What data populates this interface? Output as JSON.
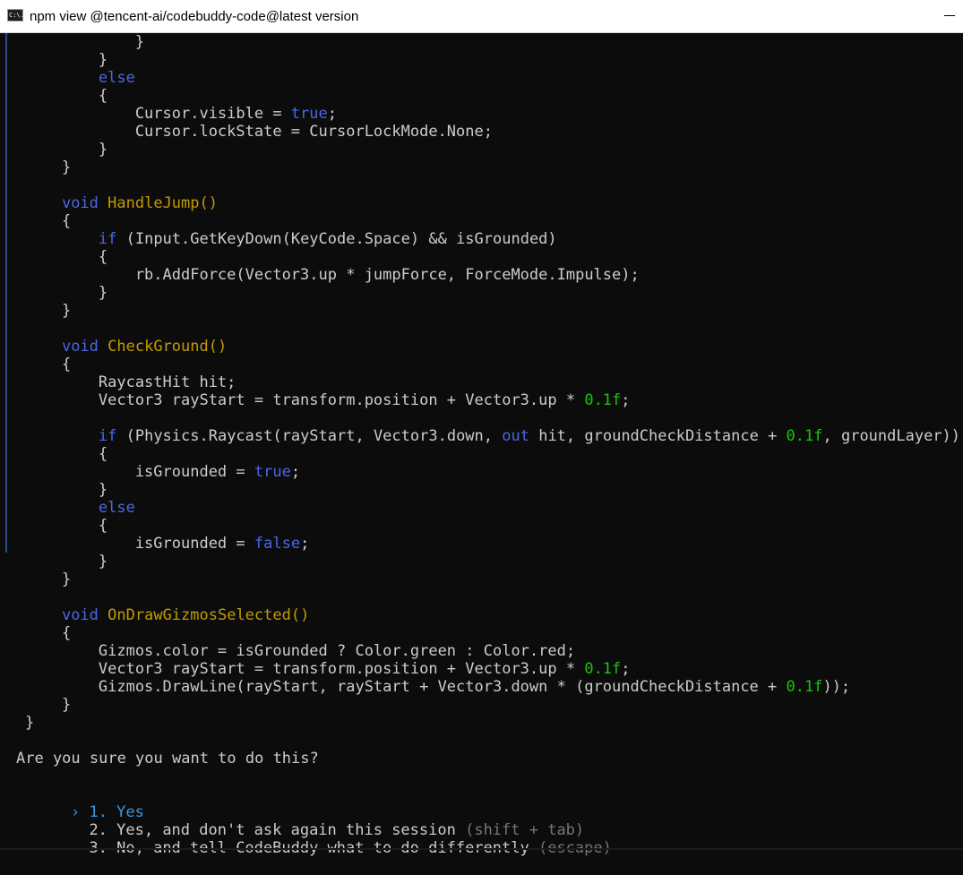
{
  "window": {
    "title": "npm view @tencent-ai/codebuddy-code@latest version",
    "icon": "console-window-icon",
    "icon_text": "C:\\."
  },
  "code_lines": [
    [
      {
        "t": "            }"
      }
    ],
    [
      {
        "t": "        }"
      }
    ],
    [
      {
        "t": "        "
      },
      {
        "t": "else",
        "c": "k"
      }
    ],
    [
      {
        "t": "        {"
      }
    ],
    [
      {
        "t": "            Cursor.visible = "
      },
      {
        "t": "true",
        "c": "k"
      },
      {
        "t": ";"
      }
    ],
    [
      {
        "t": "            Cursor.lockState = CursorLockMode.None;"
      }
    ],
    [
      {
        "t": "        }"
      }
    ],
    [
      {
        "t": "    }"
      }
    ],
    [
      {
        "t": ""
      }
    ],
    [
      {
        "t": "    "
      },
      {
        "t": "void",
        "c": "k"
      },
      {
        "t": " "
      },
      {
        "t": "HandleJump()",
        "c": "m"
      }
    ],
    [
      {
        "t": "    {"
      }
    ],
    [
      {
        "t": "        "
      },
      {
        "t": "if",
        "c": "k"
      },
      {
        "t": " (Input.GetKeyDown(KeyCode.Space) && isGrounded)"
      }
    ],
    [
      {
        "t": "        {"
      }
    ],
    [
      {
        "t": "            rb.AddForce(Vector3.up * jumpForce, ForceMode.Impulse);"
      }
    ],
    [
      {
        "t": "        }"
      }
    ],
    [
      {
        "t": "    }"
      }
    ],
    [
      {
        "t": ""
      }
    ],
    [
      {
        "t": "    "
      },
      {
        "t": "void",
        "c": "k"
      },
      {
        "t": " "
      },
      {
        "t": "CheckGround()",
        "c": "m"
      }
    ],
    [
      {
        "t": "    {"
      }
    ],
    [
      {
        "t": "        RaycastHit hit;"
      }
    ],
    [
      {
        "t": "        Vector3 rayStart = transform.position + Vector3.up * "
      },
      {
        "t": "0.1f",
        "c": "n"
      },
      {
        "t": ";"
      }
    ],
    [
      {
        "t": ""
      }
    ],
    [
      {
        "t": "        "
      },
      {
        "t": "if",
        "c": "k"
      },
      {
        "t": " (Physics.Raycast(rayStart, Vector3.down, "
      },
      {
        "t": "out",
        "c": "k"
      },
      {
        "t": " hit, groundCheckDistance + "
      },
      {
        "t": "0.1f",
        "c": "n"
      },
      {
        "t": ", groundLayer))"
      }
    ],
    [
      {
        "t": "        {"
      }
    ],
    [
      {
        "t": "            isGrounded = "
      },
      {
        "t": "true",
        "c": "k"
      },
      {
        "t": ";"
      }
    ],
    [
      {
        "t": "        }"
      }
    ],
    [
      {
        "t": "        "
      },
      {
        "t": "else",
        "c": "k"
      }
    ],
    [
      {
        "t": "        {"
      }
    ],
    [
      {
        "t": "            isGrounded = "
      },
      {
        "t": "false",
        "c": "k"
      },
      {
        "t": ";"
      }
    ],
    [
      {
        "t": "        }"
      }
    ],
    [
      {
        "t": "    }"
      }
    ],
    [
      {
        "t": ""
      }
    ],
    [
      {
        "t": "    "
      },
      {
        "t": "void",
        "c": "k"
      },
      {
        "t": " "
      },
      {
        "t": "OnDrawGizmosSelected()",
        "c": "m"
      }
    ],
    [
      {
        "t": "    {"
      }
    ],
    [
      {
        "t": "        Gizmos.color = isGrounded ? Color.green : Color.red;"
      }
    ],
    [
      {
        "t": "        Vector3 rayStart = transform.position + Vector3.up * "
      },
      {
        "t": "0.1f",
        "c": "n"
      },
      {
        "t": ";"
      }
    ],
    [
      {
        "t": "        Gizmos.DrawLine(rayStart, rayStart + Vector3.down * (groundCheckDistance + "
      },
      {
        "t": "0.1f",
        "c": "n"
      },
      {
        "t": "));"
      }
    ],
    [
      {
        "t": "    }"
      }
    ],
    [
      {
        "t": "}"
      }
    ]
  ],
  "prompt": {
    "question": "Are you sure you want to do this?",
    "cursor": "›",
    "options": [
      {
        "label": "1. Yes",
        "hint": "",
        "selected": true
      },
      {
        "label": "2. Yes, and don't ask again this session",
        "hint": "(shift + tab)",
        "selected": false
      },
      {
        "label": "3. No, and tell CodeBuddy what to do differently",
        "hint": "(escape)",
        "selected": false
      }
    ]
  },
  "colors": {
    "keyword": "#4a67e8",
    "method": "#c19c00",
    "number": "#16c60c",
    "text": "#cccccc",
    "hint": "#767676",
    "selected": "#3a96dd"
  }
}
